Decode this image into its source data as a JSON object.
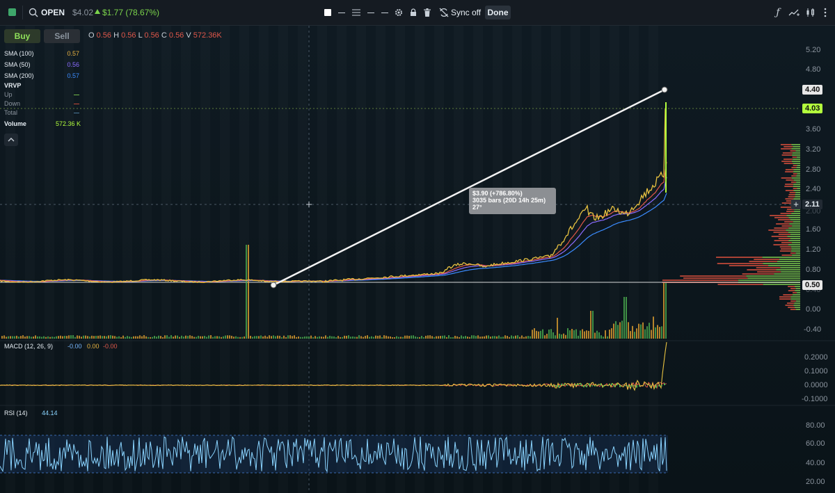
{
  "toolbar": {
    "symbol": "OPEN",
    "price": "$4.02",
    "change": "$1.77 (78.67%)",
    "sync_label": "Sync off",
    "done_label": "Done"
  },
  "order": {
    "buy_label": "Buy",
    "sell_label": "Sell"
  },
  "ohlc": {
    "o_label": "O",
    "o": "0.56",
    "h_label": "H",
    "h": "0.56",
    "l_label": "L",
    "l": "0.56",
    "c_label": "C",
    "c": "0.56",
    "v_label": "V",
    "v": "572.36K"
  },
  "indicators": {
    "sma100": {
      "label": "SMA (100)",
      "value": "0.57",
      "color": "#e8b341"
    },
    "sma50": {
      "label": "SMA (50)",
      "value": "0.56",
      "color": "#8b6cff"
    },
    "sma200": {
      "label": "SMA (200)",
      "value": "0.57",
      "color": "#3b8cff"
    },
    "vrvp": {
      "label": "VRVP"
    },
    "up": {
      "label": "Up",
      "color": "#74b94a"
    },
    "down": {
      "label": "Down",
      "color": "#c74a3a"
    },
    "total": {
      "label": "Total",
      "color": "#4b7a9c"
    },
    "volume": {
      "label": "Volume",
      "value": "572.36 K"
    }
  },
  "price_axis": [
    "5.20",
    "4.80",
    "4.40",
    "4.03",
    "3.60",
    "3.20",
    "2.80",
    "2.40",
    "2.11",
    "2.00",
    "1.60",
    "1.20",
    "0.80",
    "0.50",
    "0.40",
    "0.00",
    "-0.40"
  ],
  "tags": {
    "high": "4.40",
    "last": "4.03",
    "cursor": "2.11",
    "low": "0.50"
  },
  "measure": {
    "line1": "$3.90 (+786.80%)",
    "line2": "3035 bars (20D 14h 25m)",
    "line3": "27°"
  },
  "macd": {
    "label": "MACD (12, 26, 9)",
    "v1": "-0.00",
    "v2": "0.00",
    "v3": "-0.00",
    "axis": [
      "0.2000",
      "0.1000",
      "0.0000",
      "-0.1000"
    ]
  },
  "rsi": {
    "label": "RSI (14)",
    "value": "44.14",
    "axis": [
      "80.00",
      "60.00",
      "40.00",
      "20.00"
    ]
  },
  "colors": {
    "up": "#4caf50",
    "down": "#e0574a",
    "accent": "#b3ff3d",
    "bg": "#0b1116"
  }
}
